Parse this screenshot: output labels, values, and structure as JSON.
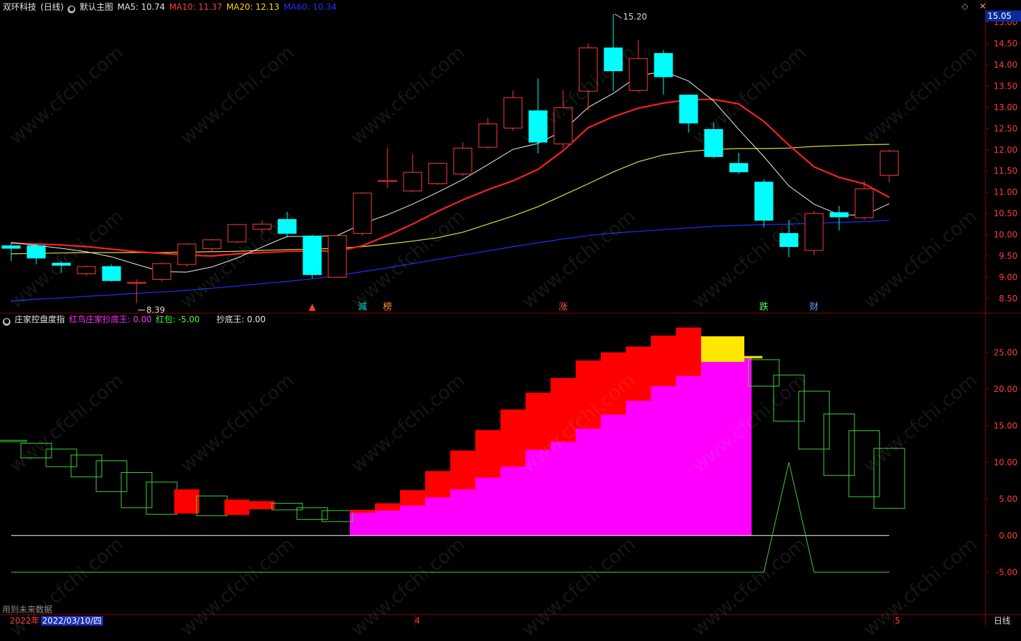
{
  "header": {
    "stock": "双环科技",
    "period_tag": "(日线)",
    "menu_icon": "circle-dot-icon",
    "main_chart_name": "默认主图",
    "ma5_label": "MA5: 10.74",
    "ma10_label": "MA10: 11.37",
    "ma20_label": "MA20: 12.13",
    "ma60_label": "MA60: 10.34",
    "current_price": "15.05",
    "top_icons": "◇ ✕"
  },
  "sub_header": {
    "indicator_name": "庄家控盘度指",
    "series1_label": "红鸟庄家抄底王: 0.00",
    "series2_label": "红包: -5.00",
    "series3_label": "抄底王: 0.00"
  },
  "footer": {
    "future_note": "用到未来数据",
    "year": "2022年",
    "selected_date": "2022/03/10/四",
    "month_4": "4",
    "month_5": "5",
    "period": "日线"
  },
  "colors": {
    "bull": "#ff3c3c",
    "bear": "#00ffff",
    "ma5": "#f0f0f0",
    "ma10": "#ff2020",
    "ma20": "#e0e040",
    "ma60": "#2030ff",
    "magenta": "#ff00ff",
    "red": "#ff0000",
    "yellow": "#ffe800",
    "green": "#3cd23c",
    "grid": "#8b0000"
  },
  "watermark": "www.cfchi.com",
  "chart_data": [
    {
      "type": "candlestick",
      "title": "双环科技 (日线)",
      "ylim": [
        8.3,
        15.2
      ],
      "yticks": [
        "15.00",
        "14.50",
        "14.00",
        "13.50",
        "13.00",
        "12.50",
        "12.00",
        "11.50",
        "11.00",
        "10.50",
        "10.00",
        "9.50",
        "9.00",
        "8.50"
      ],
      "candles": [
        {
          "o": 9.74,
          "h": 9.82,
          "l": 9.38,
          "c": 9.68
        },
        {
          "o": 9.74,
          "h": 9.8,
          "l": 9.3,
          "c": 9.45
        },
        {
          "o": 9.33,
          "h": 9.38,
          "l": 9.1,
          "c": 9.28
        },
        {
          "o": 9.08,
          "h": 9.28,
          "l": 9.03,
          "c": 9.25
        },
        {
          "o": 9.25,
          "h": 9.3,
          "l": 8.9,
          "c": 8.92
        },
        {
          "o": 8.86,
          "h": 8.95,
          "l": 8.39,
          "c": 8.88
        },
        {
          "o": 8.95,
          "h": 9.35,
          "l": 8.9,
          "c": 9.32
        },
        {
          "o": 9.3,
          "h": 9.8,
          "l": 9.25,
          "c": 9.78
        },
        {
          "o": 9.67,
          "h": 9.9,
          "l": 9.6,
          "c": 9.88
        },
        {
          "o": 9.83,
          "h": 10.25,
          "l": 9.8,
          "c": 10.24
        },
        {
          "o": 10.13,
          "h": 10.33,
          "l": 10.05,
          "c": 10.25
        },
        {
          "o": 10.36,
          "h": 10.54,
          "l": 9.93,
          "c": 10.03
        },
        {
          "o": 9.97,
          "h": 10.0,
          "l": 8.97,
          "c": 9.06
        },
        {
          "o": 9.0,
          "h": 10.0,
          "l": 8.98,
          "c": 9.98
        },
        {
          "o": 10.03,
          "h": 11.0,
          "l": 9.98,
          "c": 10.98
        },
        {
          "o": 11.25,
          "h": 12.05,
          "l": 11.1,
          "c": 11.28
        },
        {
          "o": 11.03,
          "h": 11.9,
          "l": 11.0,
          "c": 11.47
        },
        {
          "o": 11.2,
          "h": 11.7,
          "l": 11.18,
          "c": 11.68
        },
        {
          "o": 11.43,
          "h": 12.18,
          "l": 11.38,
          "c": 12.04
        },
        {
          "o": 12.06,
          "h": 12.75,
          "l": 12.03,
          "c": 12.61
        },
        {
          "o": 12.51,
          "h": 13.4,
          "l": 12.45,
          "c": 13.23
        },
        {
          "o": 12.92,
          "h": 13.68,
          "l": 11.92,
          "c": 12.18
        },
        {
          "o": 12.14,
          "h": 13.4,
          "l": 12.03,
          "c": 12.99
        },
        {
          "o": 13.38,
          "h": 14.51,
          "l": 12.92,
          "c": 14.4
        },
        {
          "o": 14.4,
          "h": 15.2,
          "l": 13.38,
          "c": 13.86
        },
        {
          "o": 13.4,
          "h": 14.58,
          "l": 13.35,
          "c": 14.15
        },
        {
          "o": 14.27,
          "h": 14.35,
          "l": 13.3,
          "c": 13.72
        },
        {
          "o": 13.29,
          "h": 13.3,
          "l": 12.4,
          "c": 12.63
        },
        {
          "o": 12.48,
          "h": 12.65,
          "l": 11.8,
          "c": 11.84
        },
        {
          "o": 11.68,
          "h": 11.93,
          "l": 11.43,
          "c": 11.48
        },
        {
          "o": 11.24,
          "h": 11.3,
          "l": 10.18,
          "c": 10.34
        },
        {
          "o": 10.03,
          "h": 10.35,
          "l": 9.47,
          "c": 9.72
        },
        {
          "o": 9.63,
          "h": 10.55,
          "l": 9.52,
          "c": 10.5
        },
        {
          "o": 10.52,
          "h": 10.68,
          "l": 10.1,
          "c": 10.42
        },
        {
          "o": 10.4,
          "h": 11.27,
          "l": 10.35,
          "c": 11.08
        },
        {
          "o": 11.4,
          "h": 12.0,
          "l": 11.23,
          "c": 11.97
        }
      ],
      "ma5": [
        9.82,
        9.75,
        9.68,
        9.6,
        9.48,
        9.3,
        9.13,
        9.12,
        9.24,
        9.45,
        9.71,
        9.96,
        9.96,
        9.98,
        10.26,
        10.47,
        10.72,
        11.0,
        11.3,
        11.65,
        12.01,
        12.15,
        12.45,
        13.0,
        13.33,
        13.74,
        13.85,
        13.62,
        13.15,
        12.48,
        11.84,
        11.15,
        10.72,
        10.47,
        10.46,
        10.73
      ],
      "ma10": [
        9.8,
        9.78,
        9.76,
        9.72,
        9.66,
        9.6,
        9.56,
        9.52,
        9.5,
        9.55,
        9.58,
        9.61,
        9.62,
        9.61,
        9.74,
        9.98,
        10.25,
        10.55,
        10.82,
        11.06,
        11.27,
        11.54,
        11.98,
        12.52,
        12.78,
        12.98,
        13.1,
        13.18,
        13.19,
        13.08,
        12.67,
        12.11,
        11.6,
        11.35,
        11.2,
        10.88
      ],
      "ma20": [
        9.55,
        9.56,
        9.57,
        9.58,
        9.58,
        9.58,
        9.58,
        9.59,
        9.6,
        9.61,
        9.63,
        9.65,
        9.66,
        9.68,
        9.72,
        9.78,
        9.85,
        9.93,
        10.06,
        10.25,
        10.44,
        10.66,
        10.93,
        11.2,
        11.48,
        11.72,
        11.88,
        11.96,
        12.01,
        12.03,
        12.03,
        12.04,
        12.08,
        12.1,
        12.12,
        12.13
      ],
      "ma60": [
        8.44,
        8.48,
        8.51,
        8.55,
        8.58,
        8.62,
        8.65,
        8.69,
        8.74,
        8.79,
        8.85,
        8.9,
        8.96,
        9.04,
        9.13,
        9.22,
        9.32,
        9.42,
        9.52,
        9.62,
        9.72,
        9.81,
        9.9,
        9.98,
        10.04,
        10.08,
        10.12,
        10.16,
        10.2,
        10.22,
        10.24,
        10.25,
        10.27,
        10.29,
        10.31,
        10.34
      ],
      "annotations": [
        "15.20",
        "8.39"
      ],
      "signals": [
        {
          "i": 12,
          "text": "▲"
        },
        {
          "i": 14,
          "text": "減"
        },
        {
          "i": 15,
          "text": "榜"
        },
        {
          "i": 22,
          "text": "涨"
        },
        {
          "i": 30,
          "text": "跌"
        },
        {
          "i": 32,
          "text": "财"
        }
      ]
    },
    {
      "type": "candlestick",
      "title": "庄家控盘度指",
      "ylim": [
        -10.5,
        29.5
      ],
      "yticks": [
        "25.00",
        "20.00",
        "15.00",
        "10.00",
        "5.00",
        "0.00",
        "-5.00"
      ],
      "boxes": [
        {
          "o": 13.0,
          "c": 13.0,
          "kind": "green"
        },
        {
          "o": 12.6,
          "c": 10.6,
          "kind": "green"
        },
        {
          "o": 11.8,
          "c": 9.4,
          "kind": "green"
        },
        {
          "o": 11.0,
          "c": 8.0,
          "kind": "green"
        },
        {
          "o": 10.2,
          "c": 6.0,
          "kind": "green"
        },
        {
          "o": 8.6,
          "c": 3.8,
          "kind": "green"
        },
        {
          "o": 7.3,
          "c": 2.9,
          "kind": "green"
        },
        {
          "o": 3.0,
          "c": 6.3,
          "kind": "red"
        },
        {
          "o": 5.4,
          "c": 2.7,
          "kind": "green"
        },
        {
          "o": 2.8,
          "c": 4.9,
          "kind": "red"
        },
        {
          "o": 3.6,
          "c": 4.7,
          "kind": "red"
        },
        {
          "o": 4.4,
          "c": 3.5,
          "kind": "green"
        },
        {
          "o": 3.8,
          "c": 2.2,
          "kind": "green"
        },
        {
          "o": 3.4,
          "c": 1.9,
          "kind": "green"
        },
        {
          "o": 3.1,
          "c": 3.5,
          "kind": "red"
        },
        {
          "o": 3.4,
          "c": 4.4,
          "kind": "red"
        },
        {
          "o": 4.1,
          "c": 6.2,
          "kind": "red"
        },
        {
          "o": 5.2,
          "c": 8.8,
          "kind": "red"
        },
        {
          "o": 6.3,
          "c": 11.6,
          "kind": "red"
        },
        {
          "o": 7.9,
          "c": 14.4,
          "kind": "red"
        },
        {
          "o": 9.4,
          "c": 17.2,
          "kind": "red"
        },
        {
          "o": 11.7,
          "c": 19.5,
          "kind": "red"
        },
        {
          "o": 12.8,
          "c": 21.5,
          "kind": "red"
        },
        {
          "o": 14.6,
          "c": 23.9,
          "kind": "red"
        },
        {
          "o": 16.5,
          "c": 25.0,
          "kind": "red"
        },
        {
          "o": 18.4,
          "c": 25.8,
          "kind": "red"
        },
        {
          "o": 20.4,
          "c": 27.3,
          "kind": "red"
        },
        {
          "o": 21.8,
          "c": 28.4,
          "kind": "red"
        },
        {
          "o": 23.7,
          "c": 27.2,
          "kind": "yellow"
        },
        {
          "o": 24.2,
          "c": 24.5,
          "kind": "yellow"
        },
        {
          "o": 24.0,
          "c": 20.4,
          "kind": "green"
        },
        {
          "o": 21.9,
          "c": 15.6,
          "kind": "green"
        },
        {
          "o": 19.7,
          "c": 11.8,
          "kind": "green"
        },
        {
          "o": 16.6,
          "c": 8.2,
          "kind": "green"
        },
        {
          "o": 14.3,
          "c": 5.3,
          "kind": "green"
        },
        {
          "o": 11.9,
          "c": 3.7,
          "kind": "green"
        }
      ],
      "magenta_fill": [
        0,
        0,
        0,
        0,
        0,
        0,
        0,
        0,
        0,
        0,
        0,
        0,
        0,
        0,
        3.5,
        4.1,
        5.2,
        6.3,
        7.9,
        9.4,
        11.7,
        12.8,
        14.6,
        16.5,
        18.4,
        20.4,
        21.8,
        23.7,
        24.2,
        24.2,
        0,
        0,
        0,
        0,
        0,
        0
      ],
      "red_bao_line": [
        -5,
        -5,
        -5,
        -5,
        -5,
        -5,
        -5,
        -5,
        -5,
        -5,
        -5,
        -5,
        -5,
        -5,
        -5,
        -5,
        -5,
        -5,
        -5,
        -5,
        -5,
        -5,
        -5,
        -5,
        -5,
        -5,
        -5,
        -5,
        -5,
        -5,
        -5,
        10,
        -5,
        -5,
        -5,
        -5
      ],
      "zero_line": 0
    }
  ]
}
